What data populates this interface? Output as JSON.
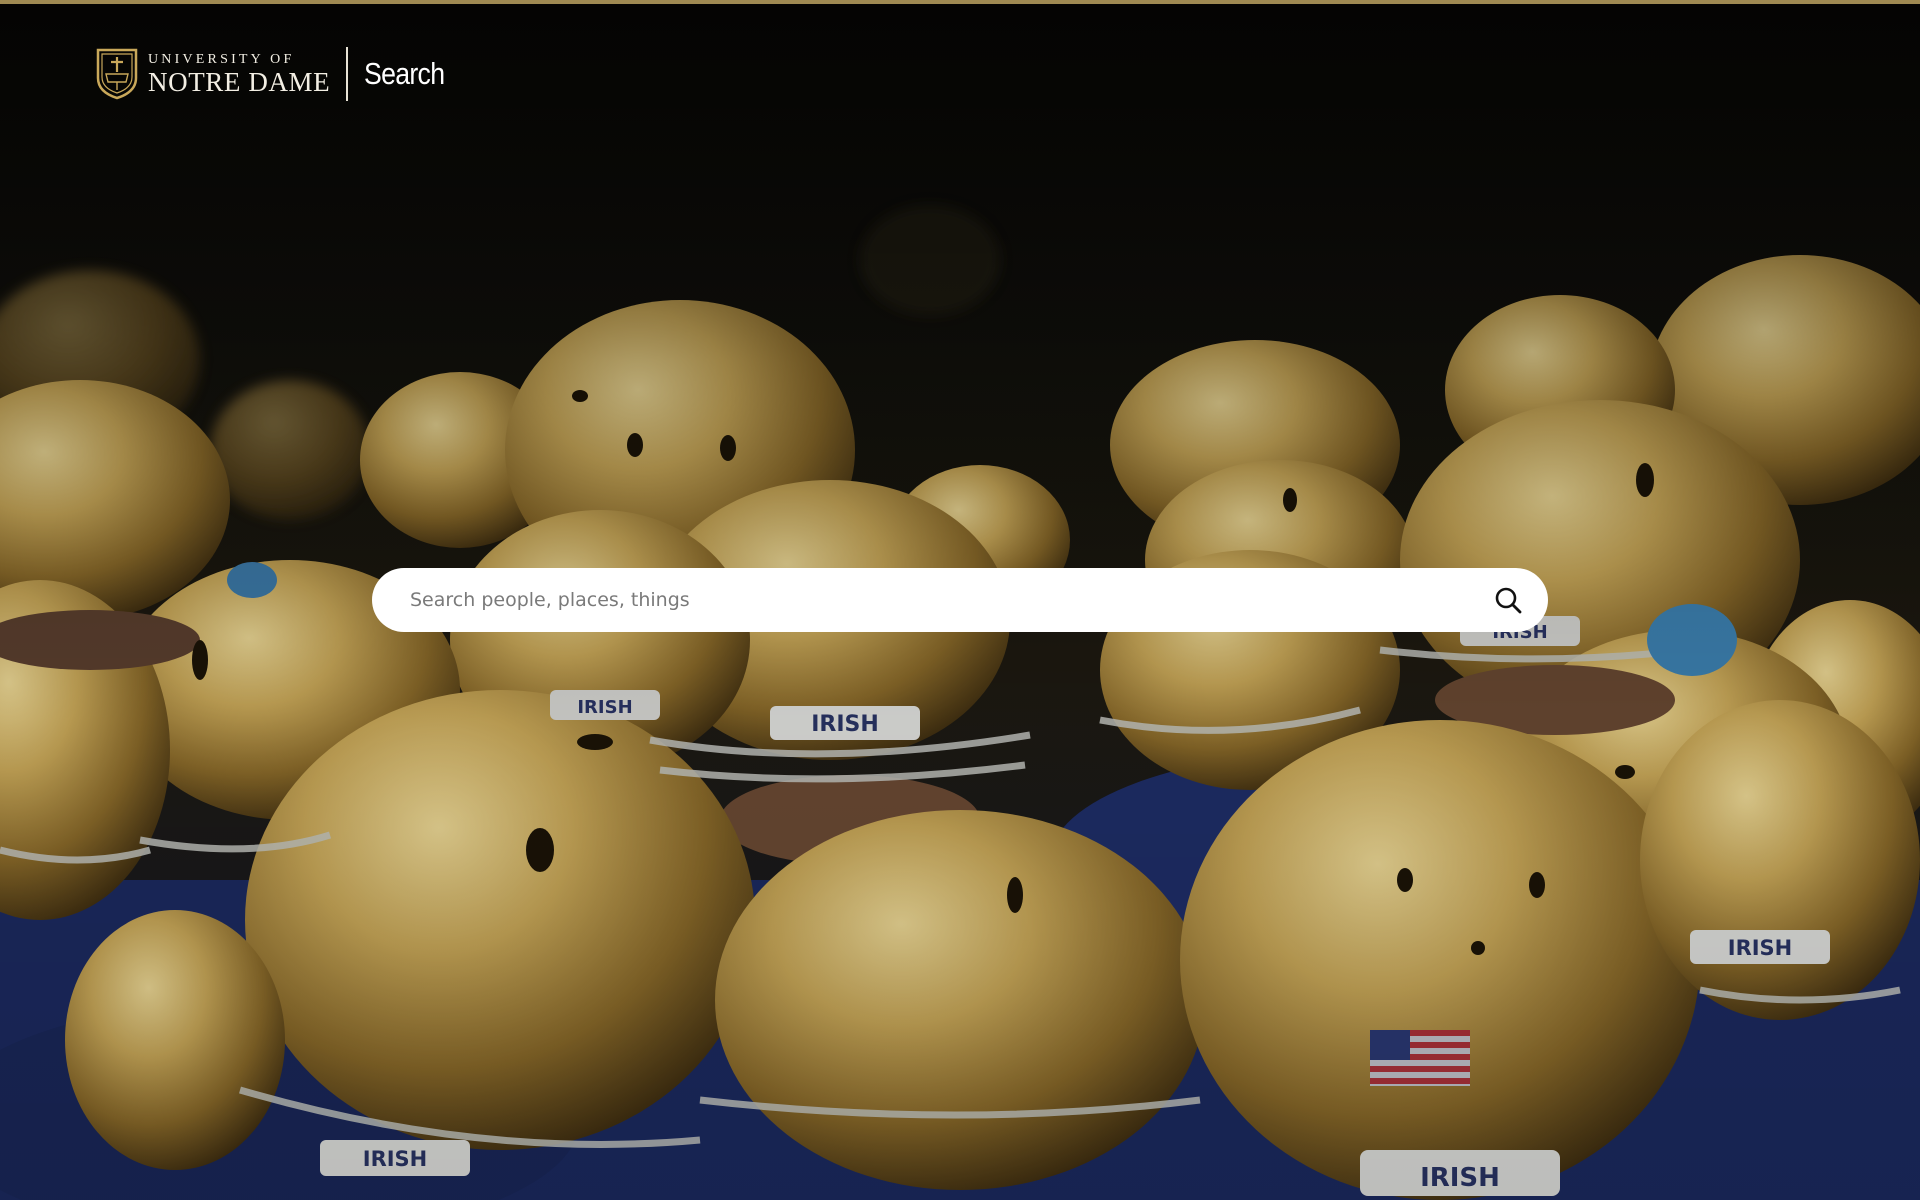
{
  "header": {
    "logo_line1": "UNIVERSITY OF",
    "logo_line2": "NOTRE DAME",
    "site_name": "Search"
  },
  "search": {
    "placeholder": "Search people, places, things",
    "value": "",
    "button_icon": "search-icon"
  },
  "hero": {
    "description_icon": "football-helmets-photo",
    "helmet_label": "IRISH"
  },
  "colors": {
    "gold_rule": "#a08a52",
    "helmet_gold": "#b8953f",
    "jersey_navy": "#1f2f6b",
    "search_bg": "#ffffff"
  }
}
